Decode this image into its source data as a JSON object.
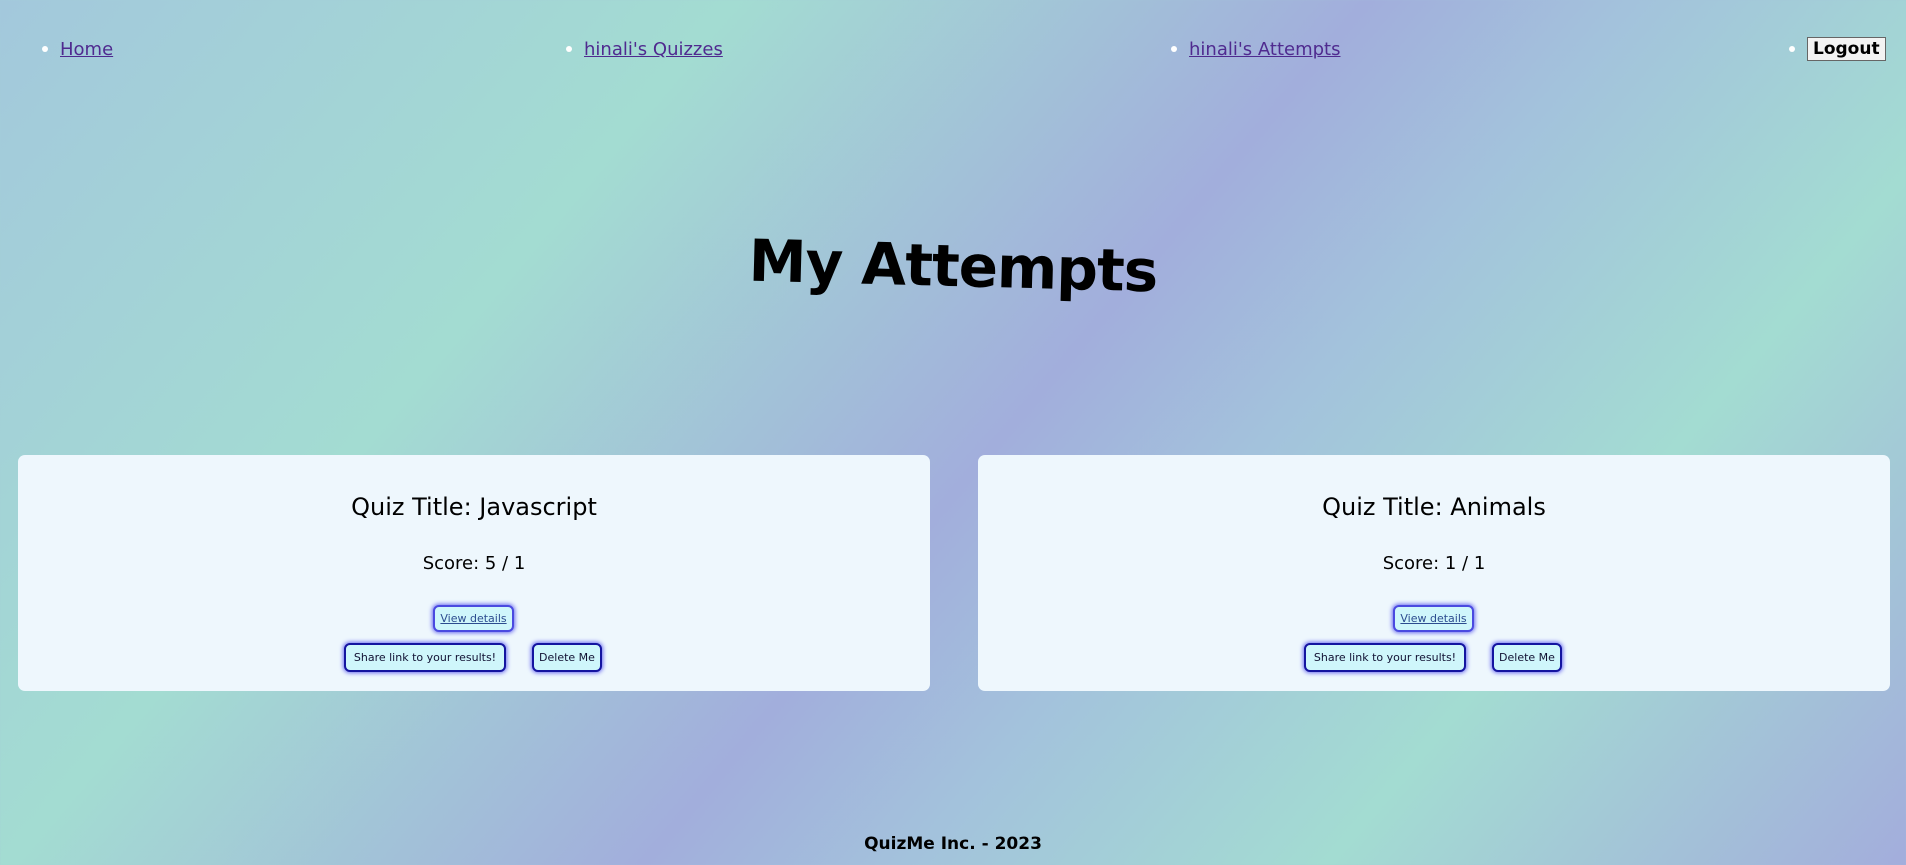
{
  "nav": {
    "home": "Home",
    "quizzes": "hinali's Quizzes",
    "attempts": "hinali's Attempts",
    "logout": "Logout"
  },
  "page_title": "My Attempts",
  "attempts": [
    {
      "title": "Quiz Title: Javascript",
      "score": "Score: 5 / 1",
      "view_details": "View details",
      "share": "Share link to your results!",
      "delete": "Delete Me"
    },
    {
      "title": "Quiz Title: Animals",
      "score": "Score: 1 / 1",
      "view_details": "View details",
      "share": "Share link to your results!",
      "delete": "Delete Me"
    }
  ],
  "footer": "QuizMe Inc. - 2023",
  "colors": {
    "link": "#4f2a8f",
    "card_bg": "#eef7fd",
    "button_bg": "#cff6fb",
    "button_border": "#1414a0"
  }
}
